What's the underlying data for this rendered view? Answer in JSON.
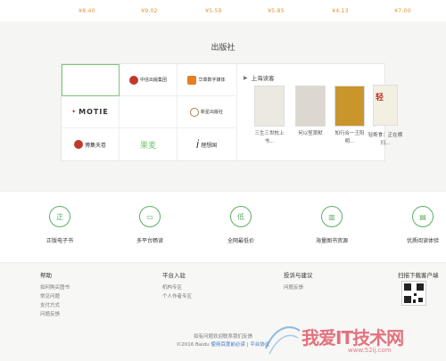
{
  "prices": [
    "¥8.40",
    "¥9.02",
    "¥5.59",
    "¥5.85",
    "¥4.13",
    "¥7.00"
  ],
  "publishers": {
    "title": "出版社",
    "logos": [
      {
        "label": "",
        "icon": "empty-icon",
        "color": "#ffffff"
      },
      {
        "label": "中信出版集团",
        "icon": "citic-logo-icon",
        "color": "#c0392b"
      },
      {
        "label": "华章数字媒体",
        "icon": "huazhang-logo-icon",
        "color": "#e67e22"
      },
      {
        "label": "MOTIE",
        "icon": "motie-logo-icon",
        "color": "#111111"
      },
      {
        "label": "",
        "icon": "empty-icon",
        "color": "#ffffff"
      },
      {
        "label": "新星出版社",
        "icon": "newstar-logo-icon",
        "color": "#b08040"
      },
      {
        "label": "博集天卷",
        "icon": "bojitianjuan-logo-icon",
        "color": "#c0392b"
      },
      {
        "label": "果麦",
        "icon": "guomai-logo-icon",
        "color": "#7cc576"
      },
      {
        "label": "理想国",
        "icon": "lixiangguo-logo-icon",
        "color": "#111111"
      }
    ],
    "reader": {
      "title": "上海读客",
      "books": [
        {
          "title": "三生三世枕上书...",
          "color": "#e9e6dd"
        },
        {
          "title": "何以笙箫默",
          "color": "#d9d6cf"
        },
        {
          "title": "知行合一王阳明...",
          "color": "#c9962c"
        },
        {
          "title": "轻断食：正在横扫...",
          "color": "#f2ede2"
        }
      ]
    }
  },
  "features": [
    {
      "label": "正版电子书",
      "icon": "genuine-icon",
      "glyph": "正"
    },
    {
      "label": "多平台畅读",
      "icon": "multi-device-icon",
      "glyph": "▭"
    },
    {
      "label": "全网最低价",
      "icon": "lowest-price-icon",
      "glyph": "低"
    },
    {
      "label": "海量图书资源",
      "icon": "library-icon",
      "glyph": "▥"
    },
    {
      "label": "优质阅读体验",
      "icon": "reading-icon",
      "glyph": "▤"
    }
  ],
  "footer": {
    "help": {
      "title": "帮助",
      "links": [
        "如何购买图书",
        "常见问题",
        "支付方式",
        "问题反馈"
      ]
    },
    "platform": {
      "title": "平台入驻",
      "links": [
        "机构专区",
        "个人作者专区"
      ]
    },
    "complaint": {
      "title": "投诉与建议",
      "links": [
        "问题反馈"
      ]
    },
    "app": {
      "title": "扫描下载客户端"
    },
    "copyright_line1": "如有问题欢迎联系我们反馈",
    "copyright_prefix": "©2016 Baidu",
    "copyright_links": [
      "使用百度前必读",
      "平台协议"
    ]
  },
  "watermark": {
    "text": "我爱IT技术网",
    "url": "www.52ij.com"
  }
}
